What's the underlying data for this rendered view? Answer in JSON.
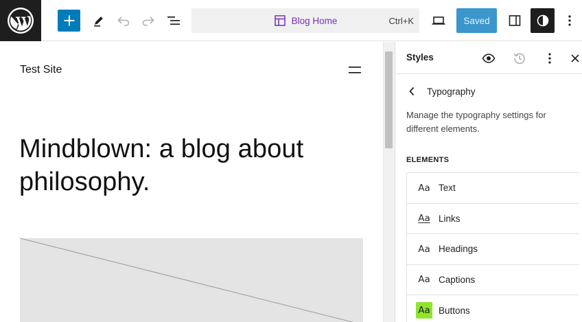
{
  "colors": {
    "accent": "#007cba",
    "command_text": "#7a2fb3",
    "button_swatch": "#8ee52c"
  },
  "toolbar": {
    "add_icon": "plus-icon",
    "tools_icon": "pen-icon",
    "undo_icon": "undo-icon",
    "redo_icon": "redo-icon",
    "list_view_icon": "list-view-icon",
    "command_label": "Blog Home",
    "command_shortcut": "Ctrl+K",
    "preview_icon": "desktop-preview-icon",
    "save_label": "Saved",
    "sidebar_icon": "sidebar-icon",
    "styles_icon": "contrast-icon",
    "options_icon": "more-vertical-icon"
  },
  "canvas": {
    "site_title": "Test Site",
    "headline": "Mindblown: a blog about philosophy."
  },
  "styles_panel": {
    "title": "Styles",
    "nav_title": "Typography",
    "description": "Manage the typography settings for different elements.",
    "section_label": "ELEMENTS",
    "elements": [
      {
        "swatch": "Aa",
        "label": "Text"
      },
      {
        "swatch": "Aa",
        "label": "Links"
      },
      {
        "swatch": "Aa",
        "label": "Headings"
      },
      {
        "swatch": "Aa",
        "label": "Captions"
      },
      {
        "swatch": "Aa",
        "label": "Buttons"
      }
    ]
  }
}
